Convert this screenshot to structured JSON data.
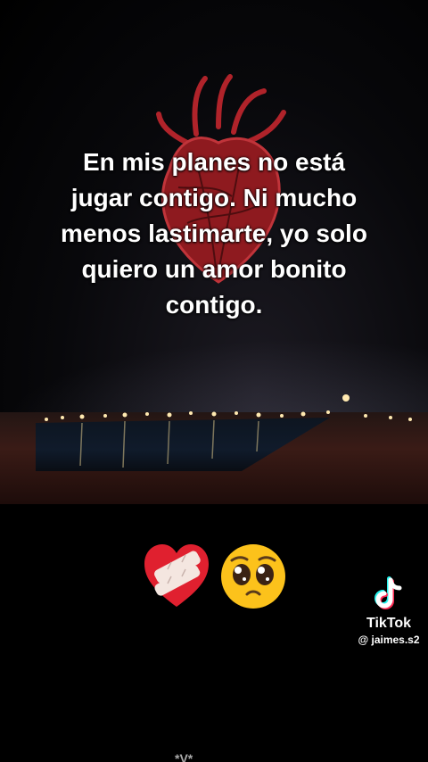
{
  "post": {
    "quote_lines": [
      "En mis planes no está",
      "jugar contigo. Ni mucho",
      "menos lastimarte, yo solo",
      "quiero un amor bonito",
      "contigo."
    ]
  },
  "emojis": {
    "icons": [
      "mending-heart-icon",
      "pleading-face-icon"
    ]
  },
  "watermark": {
    "brand": "TikTok",
    "username": "@ jaimes.s2"
  },
  "bottom_fragment": "*V*",
  "colors": {
    "background": "#000000",
    "heart_red": "#b0232a",
    "text": "#ffffff",
    "tiktok_cyan": "#25f4ee",
    "tiktok_pink": "#fe2c55"
  }
}
